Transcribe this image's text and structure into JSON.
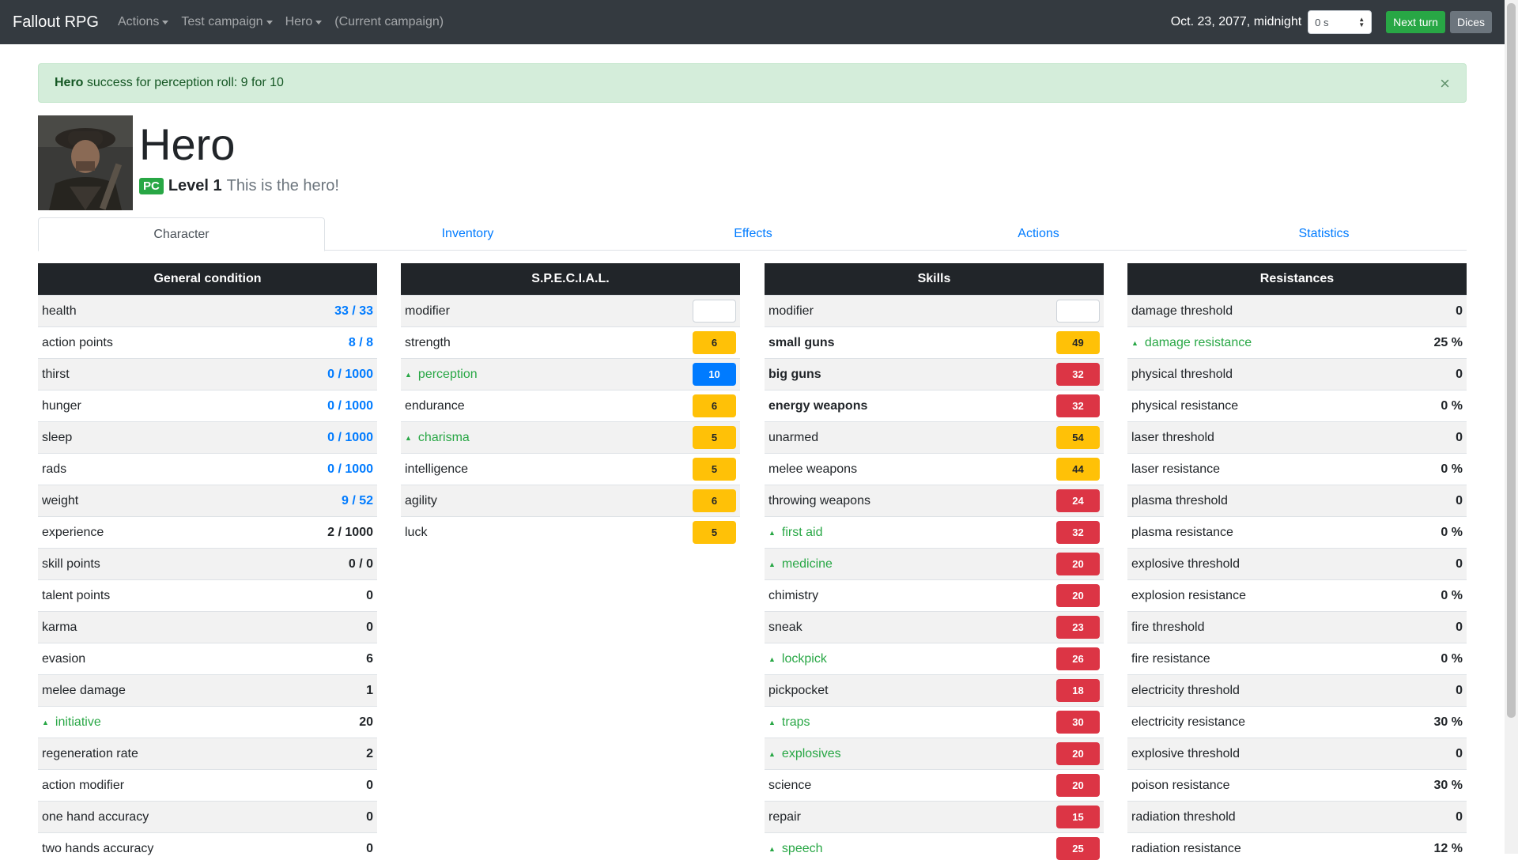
{
  "nav": {
    "brand": "Fallout RPG",
    "menus": [
      {
        "label": "Actions"
      },
      {
        "label": "Test campaign"
      },
      {
        "label": "Hero"
      }
    ],
    "current": "(Current campaign)",
    "date": "Oct. 23, 2077, midnight",
    "time_select": "0 s",
    "next_turn": "Next turn",
    "dices": "Dices",
    "colors": {
      "navbar": "#343a40",
      "success": "#28a745",
      "secondary": "#6c757d"
    }
  },
  "alert": {
    "name": "Hero",
    "text": "success for perception roll: 9 for 10",
    "close": "×"
  },
  "hero": {
    "name": "Hero",
    "badge": "PC",
    "level": "Level 1",
    "description": "This is the hero!"
  },
  "tabs": [
    "Character",
    "Inventory",
    "Effects",
    "Actions",
    "Statistics"
  ],
  "general": {
    "title": "General condition",
    "rows": [
      {
        "label": "health",
        "value": "33 / 33"
      },
      {
        "label": "action points",
        "value": "8 / 8"
      },
      {
        "label": "thirst",
        "value": "0 / 1000"
      },
      {
        "label": "hunger",
        "value": "0 / 1000"
      },
      {
        "label": "sleep",
        "value": "0 / 1000"
      },
      {
        "label": "rads",
        "value": "0 / 1000"
      },
      {
        "label": "weight",
        "value": "9 / 52"
      },
      {
        "label": "experience",
        "value": "2 / 1000"
      },
      {
        "label": "skill points",
        "value": "0 / 0"
      },
      {
        "label": "talent points",
        "value": "0"
      },
      {
        "label": "karma",
        "value": "0"
      },
      {
        "label": "evasion",
        "value": "6"
      },
      {
        "label": "melee damage",
        "value": "1"
      },
      {
        "label": "initiative",
        "value": "20"
      },
      {
        "label": "regeneration rate",
        "value": "2"
      },
      {
        "label": "action modifier",
        "value": "0"
      },
      {
        "label": "one hand accuracy",
        "value": "0"
      },
      {
        "label": "two hands accuracy",
        "value": "0"
      }
    ]
  },
  "special": {
    "title": "S.P.E.C.I.A.L.",
    "rows": [
      {
        "label": "modifier",
        "value": ""
      },
      {
        "label": "strength",
        "value": "6"
      },
      {
        "label": "perception",
        "value": "10"
      },
      {
        "label": "endurance",
        "value": "6"
      },
      {
        "label": "charisma",
        "value": "5"
      },
      {
        "label": "intelligence",
        "value": "5"
      },
      {
        "label": "agility",
        "value": "6"
      },
      {
        "label": "luck",
        "value": "5"
      }
    ]
  },
  "skills": {
    "title": "Skills",
    "rows": [
      {
        "label": "modifier",
        "value": ""
      },
      {
        "label": "small guns",
        "value": "49"
      },
      {
        "label": "big guns",
        "value": "32"
      },
      {
        "label": "energy weapons",
        "value": "32"
      },
      {
        "label": "unarmed",
        "value": "54"
      },
      {
        "label": "melee weapons",
        "value": "44"
      },
      {
        "label": "throwing weapons",
        "value": "24"
      },
      {
        "label": "first aid",
        "value": "32"
      },
      {
        "label": "medicine",
        "value": "20"
      },
      {
        "label": "chimistry",
        "value": "20"
      },
      {
        "label": "sneak",
        "value": "23"
      },
      {
        "label": "lockpick",
        "value": "26"
      },
      {
        "label": "pickpocket",
        "value": "18"
      },
      {
        "label": "traps",
        "value": "30"
      },
      {
        "label": "explosives",
        "value": "20"
      },
      {
        "label": "science",
        "value": "20"
      },
      {
        "label": "repair",
        "value": "15"
      },
      {
        "label": "speech",
        "value": "25"
      }
    ]
  },
  "resistances": {
    "title": "Resistances",
    "rows": [
      {
        "label": "damage threshold",
        "value": "0"
      },
      {
        "label": "damage resistance",
        "value": "25 %"
      },
      {
        "label": "physical threshold",
        "value": "0"
      },
      {
        "label": "physical resistance",
        "value": "0 %"
      },
      {
        "label": "laser threshold",
        "value": "0"
      },
      {
        "label": "laser resistance",
        "value": "0 %"
      },
      {
        "label": "plasma threshold",
        "value": "0"
      },
      {
        "label": "plasma resistance",
        "value": "0 %"
      },
      {
        "label": "explosive threshold",
        "value": "0"
      },
      {
        "label": "explosion resistance",
        "value": "0 %"
      },
      {
        "label": "fire threshold",
        "value": "0"
      },
      {
        "label": "fire resistance",
        "value": "0 %"
      },
      {
        "label": "electricity threshold",
        "value": "0"
      },
      {
        "label": "electricity resistance",
        "value": "30 %"
      },
      {
        "label": "explosive threshold",
        "value": "0"
      },
      {
        "label": "poison resistance",
        "value": "30 %"
      },
      {
        "label": "radiation threshold",
        "value": "0"
      },
      {
        "label": "radiation resistance",
        "value": "12 %"
      }
    ]
  }
}
